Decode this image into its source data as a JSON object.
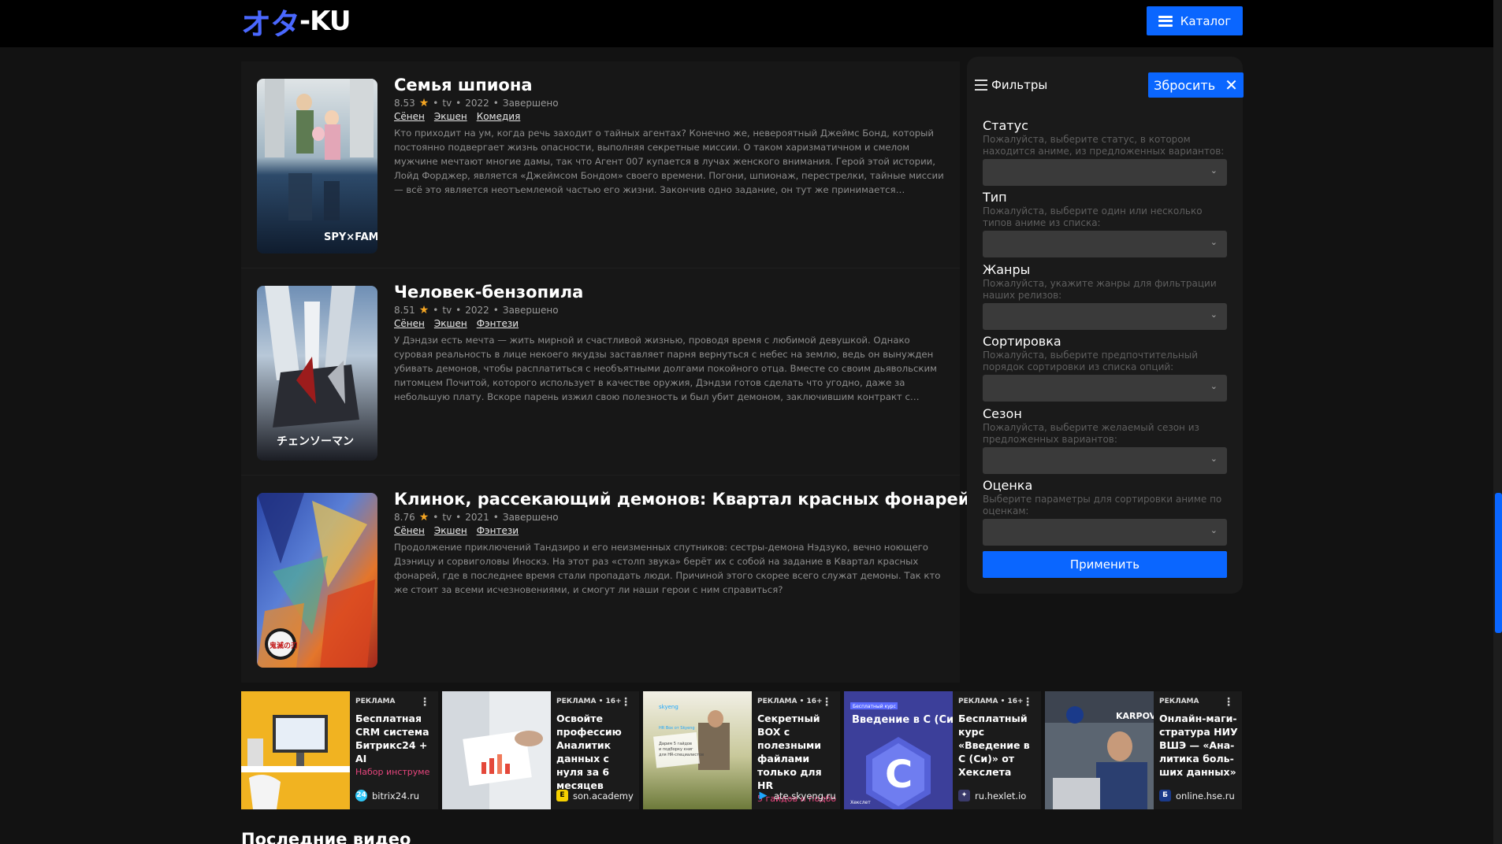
{
  "header": {
    "logo_jp": "オタ",
    "logo_ku": "-KU",
    "catalog_label": "Каталог"
  },
  "cards": [
    {
      "title": "Семья шпиона",
      "rating": "8.53",
      "type": "tv",
      "year": "2022",
      "status": "Завершено",
      "genres": [
        "Сёнен",
        "Экшен",
        "Комедия"
      ],
      "description": "Кто приходит на ум, когда речь заходит о тайных агентах? Конечно же, невероятный Джеймс Бонд, который постоянно подвергает жизнь опасности, выполняя секретные миссии. О таком харизматичном и смелом мужчине мечтают многие дамы, так что Агент 007 купается в лучах женского внимания. Герой этой истории, Лойд Форджер, является «Джеймсом Бондом» своего времени. Погони, шпионаж, перестрелки, тайные миссии — всё это является неотъемлемой частью его жизни. Закончив одно задание, он тут же принимается…",
      "poster_text": "SPY×FAMILY"
    },
    {
      "title": "Человек-бензопила",
      "rating": "8.51",
      "type": "tv",
      "year": "2022",
      "status": "Завершено",
      "genres": [
        "Сёнен",
        "Экшен",
        "Фэнтези"
      ],
      "description": "У Дэндзи есть мечта — жить мирной и счастливой жизнью, проводя время с любимой девушкой. Однако суровая реальность в лице некоего якудзы заставляет парня вернуться с небес на землю, ведь он вынужден убивать демонов, чтобы расплатиться с необъятными долгами покойного отца. Вместе со своим дьявольским питомцем Почитой, которого использует в качестве оружия, Дэндзи готов сделать что угодно, даже за небольшую плату. Вскоре парень изжил свою полезность и был убит демоном, заключившим контракт с…",
      "poster_text": "チェンソーマン"
    },
    {
      "title": "Клинок, рассекающий демонов: Квартал красных фонарей",
      "rating": "8.76",
      "type": "tv",
      "year": "2021",
      "status": "Завершено",
      "genres": [
        "Сёнен",
        "Экшен",
        "Фэнтези"
      ],
      "description": "Продолжение приключений Тандзиро и его неизменных спутников: сестры-демона Нэдзуко, вечно ноющего Дзэницу и сорвиголовы Иноскэ. На этот раз «столп звука» берёт их с собой на задание в Квартал красных фонарей, где в последнее время стали пропадать люди. Причиной этого скорее всего служат демоны. Так кто же стоит за всеми исчезновениями, и смогут ли наши герои с ним справиться?",
      "poster_text": "鬼滅の刃"
    }
  ],
  "filters": {
    "title": "Фильтры",
    "reset_label": "Збросить",
    "apply_label": "Применить",
    "groups": [
      {
        "label": "Статус",
        "hint": "Пожалуйста, выберите статус, в котором находится аниме, из предложенных вариантов:"
      },
      {
        "label": "Тип",
        "hint": "Пожалуйста, выберите один или несколько типов аниме из списка:"
      },
      {
        "label": "Жанры",
        "hint": "Пожалуйста, укажите жанры для фильтрации наших релизов:"
      },
      {
        "label": "Сортировка",
        "hint": "Пожалуйста, выберите предпочтительный порядок сортировки из списка опций:"
      },
      {
        "label": "Сезон",
        "hint": "Пожалуйста, выберите желаемый сезон из предложенных вариантов:"
      },
      {
        "label": "Оценка",
        "hint": "Выберите параметры для сортировки аниме по оценкам:"
      }
    ]
  },
  "ads": [
    {
      "label": "РЕКЛАМА",
      "title": "Бесплатная CRM система Битрикс24 + AI",
      "promo": "Набор инструме",
      "site": "bitrix24.ru",
      "icon": "24",
      "icon_color": "#2fc6f6"
    },
    {
      "label": "РЕКЛАМА • 16+",
      "title": "Освойте профессию Аналитик данных с нуля за 6 месяцев",
      "promo": "",
      "site": "son.academy",
      "icon": "E",
      "icon_color": "#f5d000"
    },
    {
      "label": "РЕКЛАМА • 16+",
      "title": "Секретный BOX с полезными файлами только для HR",
      "promo": "5 гайдов и подбо",
      "site": "ate.skyeng.ru",
      "icon": "▶",
      "icon_color": "#1ea7fd"
    },
    {
      "label": "РЕКЛАМА • 16+",
      "title": "Бесплатный курс «Введение в С (Си)» от Хекслета",
      "promo": "",
      "site": "ru.hexlet.io",
      "icon": "✦",
      "icon_color": "#3a3a6a"
    },
    {
      "label": "РЕКЛАМА",
      "title": "Онлайн-маги-стратура НИУ ВШЭ — «Ана-литика боль-ших данных»",
      "promo": "",
      "site": "online.hse.ru",
      "icon": "Б",
      "icon_color": "#1a3a8a"
    }
  ],
  "ad_images": {
    "hexlet_badge": "Бесплатный курс",
    "hexlet_title": "Введение в С (Си)",
    "hexlet_brand": "Хекслет",
    "karpov_text": "KARPOV.CO",
    "skyeng_brand": "skyeng",
    "skyeng_lines": [
      "HR Box от Skyeng",
      "Дарим 5 гайдов",
      "и подборку книг",
      "для HR-специалистов"
    ]
  },
  "sections": {
    "latest_videos": "Последние видео"
  },
  "colors": {
    "accent": "#0a66ff",
    "star": "#f5a623",
    "background": "#121212"
  }
}
